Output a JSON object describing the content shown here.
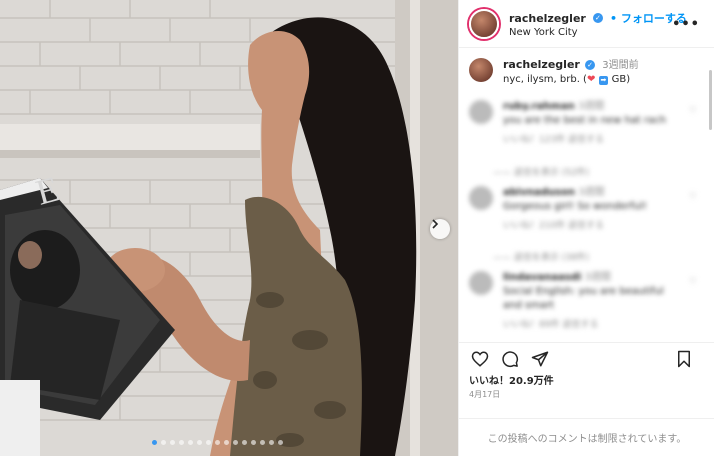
{
  "post": {
    "username": "rachelzegler",
    "follow_label": "フォローする",
    "location": "New York City",
    "caption_username": "rachelzegler",
    "caption_time": "3週間前",
    "caption_text": "nyc, ilysm, brb. (",
    "caption_suffix": "GB)",
    "likes": "いいね！20.9万件",
    "date": "4月17日",
    "comments_limited": "この投稿へのコメントは制限されています。",
    "slide_count": 15,
    "active_slide": 0
  },
  "comments": [
    {
      "user": "ruby.rahman",
      "time": "3週間",
      "text": "you are the best in new hat rach",
      "meta": "いいね！123件  返信する",
      "replies": "——  返信を表示 (52件)"
    },
    {
      "user": "abivnaduson",
      "time": "3週間",
      "text": "Gorgeous girl! So wonderful!",
      "meta": "いいね！210件  返信する",
      "replies": "——  返信を表示 (38件)"
    },
    {
      "user": "lindavanaasdi",
      "time": "3週間",
      "text": "Social English: you are beautiful and smart",
      "meta": "いいね！89件  返信する",
      "replies": "——  返信を表示 (21件)"
    }
  ],
  "icons": {
    "more": "more-icon",
    "like": "heart-icon",
    "comment": "comment-icon",
    "share": "send-icon",
    "save": "bookmark-icon",
    "next": "chevron-right-icon"
  },
  "colors": {
    "link": "#0095f6",
    "heart": "#ed4956",
    "muted": "#8e8e8e"
  }
}
